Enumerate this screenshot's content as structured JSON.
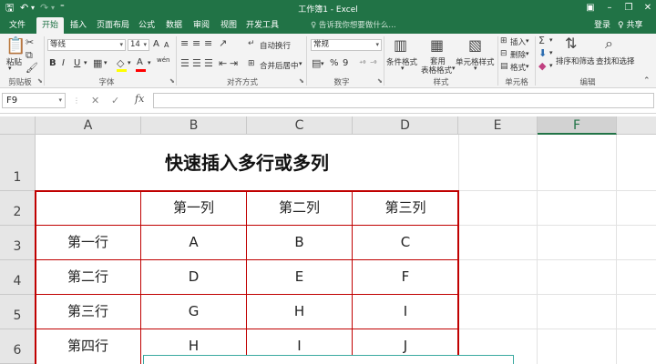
{
  "titlebar": {
    "save_icon": "save-icon",
    "undo_icon": "undo-icon",
    "redo_icon": "redo-icon",
    "title": "工作簿1 - Excel",
    "colors": {
      "brand": "#217346"
    }
  },
  "tabs": [
    {
      "label": "文件",
      "active": false
    },
    {
      "label": "开始",
      "active": true
    },
    {
      "label": "插入",
      "active": false
    },
    {
      "label": "页面布局",
      "active": false
    },
    {
      "label": "公式",
      "active": false
    },
    {
      "label": "数据",
      "active": false
    },
    {
      "label": "审阅",
      "active": false
    },
    {
      "label": "视图",
      "active": false
    },
    {
      "label": "开发工具",
      "active": false
    }
  ],
  "tellme": "♀ 告诉我你想要做什么...",
  "account": {
    "login": "登录",
    "share": "♀ 共享"
  },
  "ribbon": {
    "clipboard": {
      "paste": "粘贴",
      "label": "剪贴板"
    },
    "font": {
      "name": "等线",
      "size": "14",
      "label": "字体",
      "bold": "B",
      "italic": "I",
      "underline": "U",
      "font_color": "A",
      "grow": "A",
      "shrink": "A",
      "wen": "wén"
    },
    "alignment": {
      "wrap": "自动换行",
      "merge": "合并后居中",
      "label": "对齐方式"
    },
    "number": {
      "format": "常规",
      "percent": "%",
      "comma": "9",
      "label": "数字"
    },
    "styles": {
      "conditional": "条件格式",
      "table_line1": "套用",
      "table_line2": "表格格式",
      "cell_styles": "单元格样式",
      "label": "样式"
    },
    "cells": {
      "insert": "插入",
      "delete": "删除",
      "format": "格式",
      "label": "单元格"
    },
    "editing": {
      "sort": "排序和筛选",
      "find": "查找和选择",
      "label": "编辑"
    }
  },
  "formula_bar": {
    "name_box": "F9",
    "formula": "",
    "fx": "fx"
  },
  "grid": {
    "columns": [
      "A",
      "B",
      "C",
      "D",
      "E",
      "F"
    ],
    "selected_column": "F",
    "rows": [
      "1",
      "2",
      "3",
      "4",
      "5",
      "6"
    ],
    "title": "快速插入多行或多列",
    "header_row": [
      "",
      "第一列",
      "第二列",
      "第三列"
    ],
    "data_rows": [
      [
        "第一行",
        "A",
        "B",
        "C"
      ],
      [
        "第二行",
        "D",
        "E",
        "F"
      ],
      [
        "第三行",
        "G",
        "H",
        "I"
      ],
      [
        "第四行",
        "H",
        "I",
        "J"
      ]
    ]
  }
}
